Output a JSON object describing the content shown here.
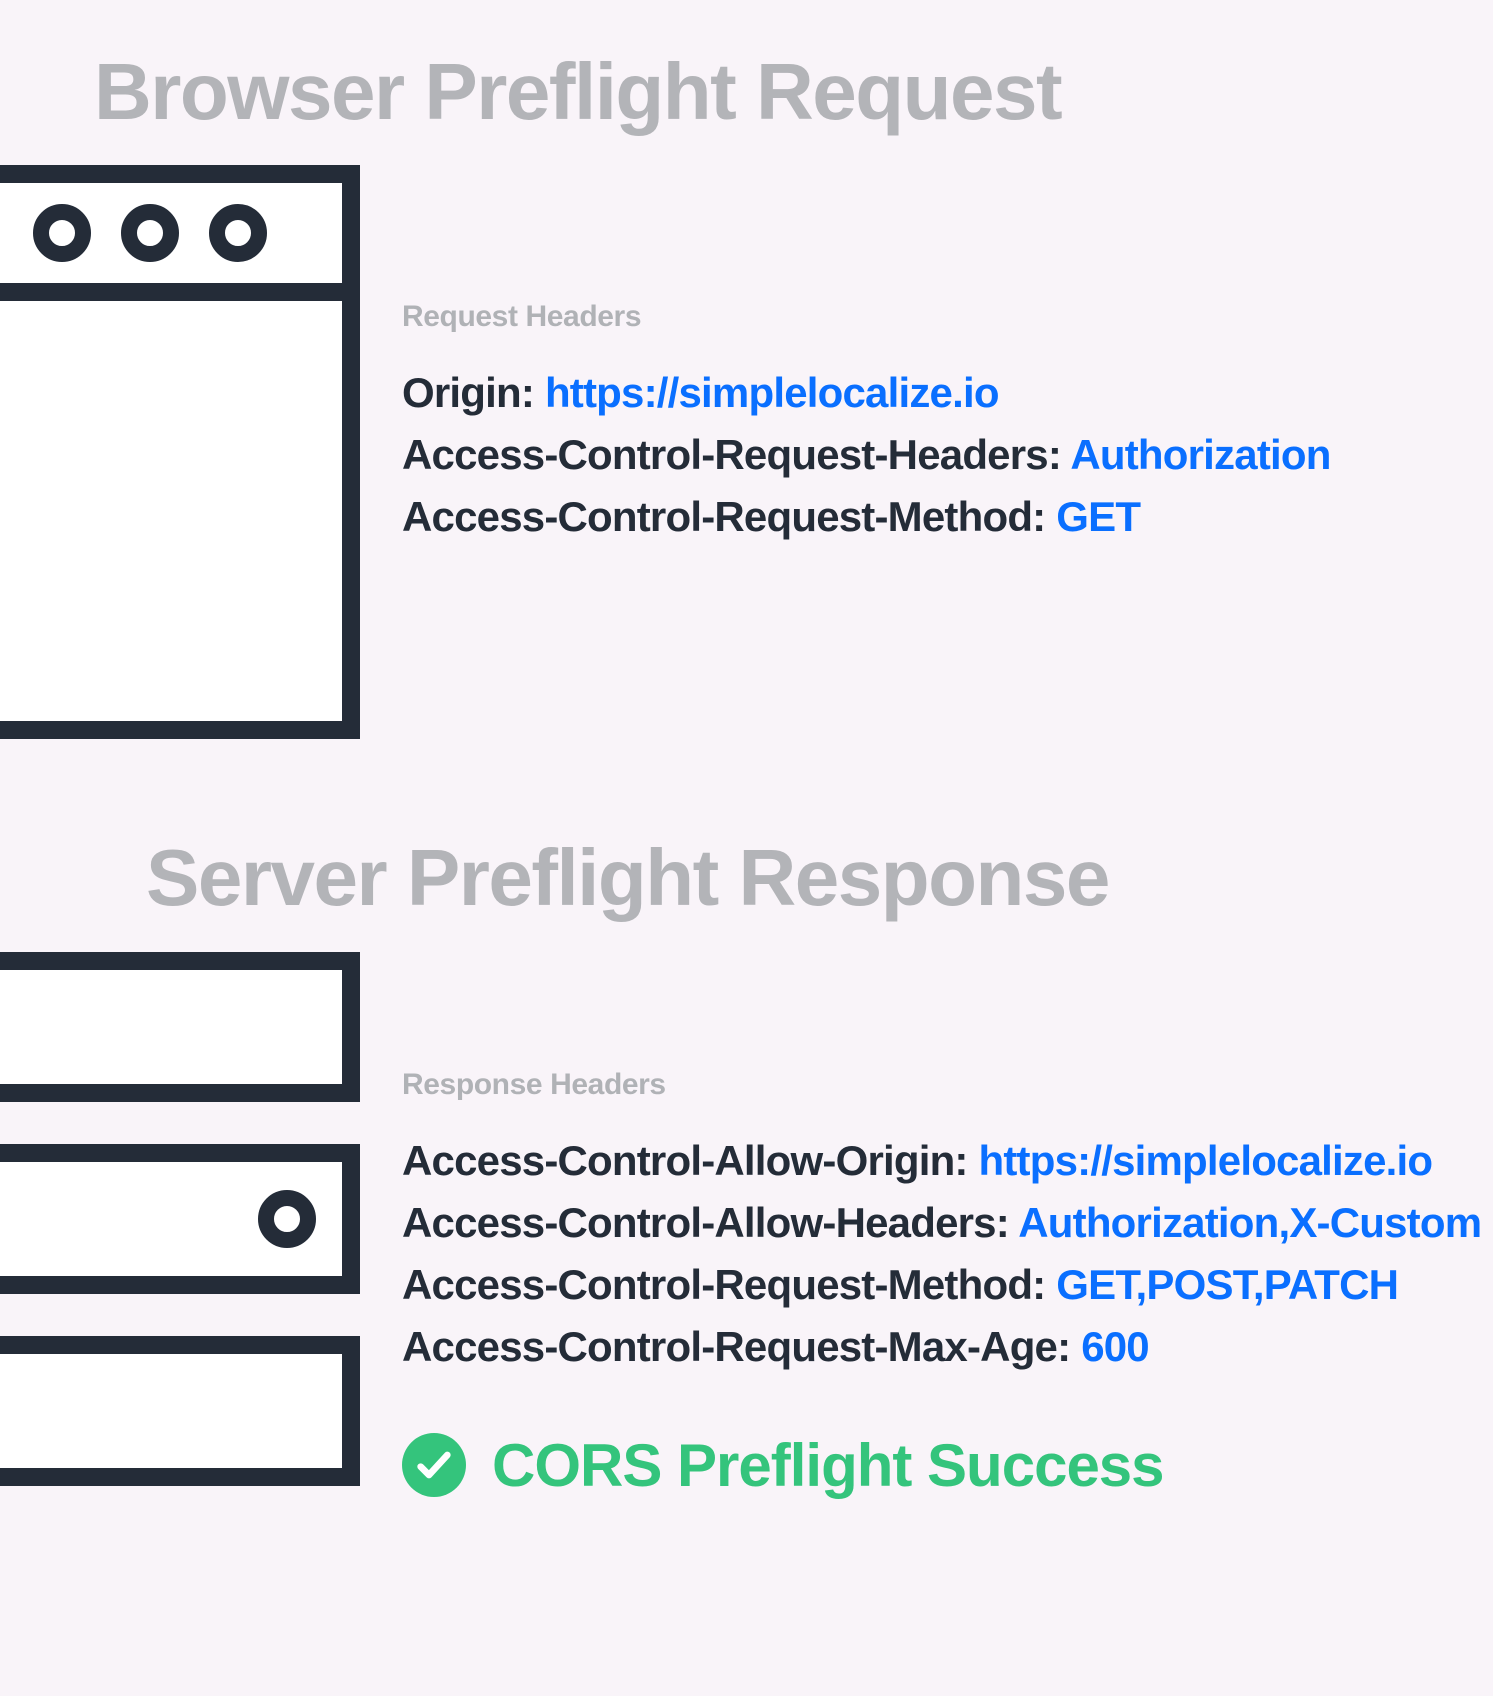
{
  "request": {
    "heading": "Browser Preflight Request",
    "sub": "Request Headers",
    "headers": [
      {
        "k": "Origin:",
        "v": "https://simplelocalize.io"
      },
      {
        "k": "Access-Control-Request-Headers:",
        "v": "Authorization"
      },
      {
        "k": "Access-Control-Request-Method:",
        "v": "GET"
      }
    ]
  },
  "response": {
    "heading": "Server Preflight Response",
    "sub": "Response Headers",
    "headers": [
      {
        "k": "Access-Control-Allow-Origin:",
        "v": "https://simplelocalize.io"
      },
      {
        "k": "Access-Control-Allow-Headers:",
        "v": "Authorization,X-Custom"
      },
      {
        "k": "Access-Control-Request-Method:",
        "v": "GET,POST,PATCH"
      },
      {
        "k": "Access-Control-Request-Max-Age:",
        "v": "600"
      }
    ],
    "success": "CORS Preflight Success"
  }
}
